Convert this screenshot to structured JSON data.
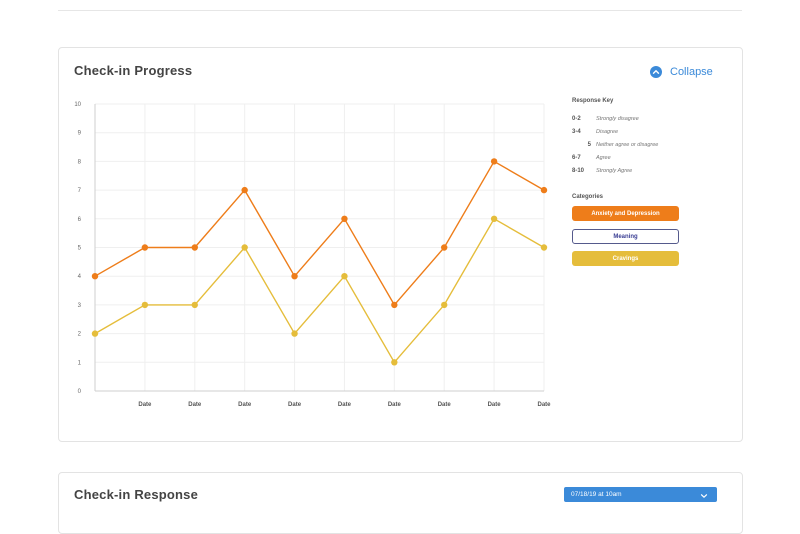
{
  "progress": {
    "title": "Check-in Progress",
    "collapse_label": "Collapse"
  },
  "response_key": {
    "title": "Response Key",
    "rows": [
      {
        "range": "0-2",
        "desc": "Strongly disagree"
      },
      {
        "range": "3-4",
        "desc": "Disagree"
      },
      {
        "range": "5",
        "desc": "Neither agree or disagree"
      },
      {
        "range": "6-7",
        "desc": "Agree"
      },
      {
        "range": "8-10",
        "desc": "Strongly Agree"
      }
    ]
  },
  "categories": {
    "title": "Categories",
    "items": [
      "Anxiety and Depression",
      "Meaning",
      "Cravings"
    ]
  },
  "response": {
    "title": "Check-in Response",
    "selected": "07/18/19 at 10am"
  },
  "colors": {
    "anxiety": "#ee7d1a",
    "cravings": "#e5bd3b",
    "meaning": "#3b3f94",
    "accent": "#3b8ad9"
  },
  "chart_data": {
    "type": "line",
    "categories": [
      "",
      "Date",
      "Date",
      "Date",
      "Date",
      "Date",
      "Date",
      "Date",
      "Date",
      "Date"
    ],
    "y_ticks": [
      0,
      1,
      2,
      3,
      4,
      5,
      6,
      7,
      8,
      9,
      10
    ],
    "ylim": [
      0,
      10
    ],
    "grid": true,
    "series": [
      {
        "name": "Anxiety and Depression",
        "color": "#ee7d1a",
        "values": [
          4,
          5,
          5,
          7,
          4,
          6,
          3,
          5,
          8,
          7
        ]
      },
      {
        "name": "Cravings",
        "color": "#e5bd3b",
        "values": [
          2,
          3,
          3,
          5,
          2,
          4,
          1,
          3,
          6,
          5
        ]
      }
    ]
  }
}
